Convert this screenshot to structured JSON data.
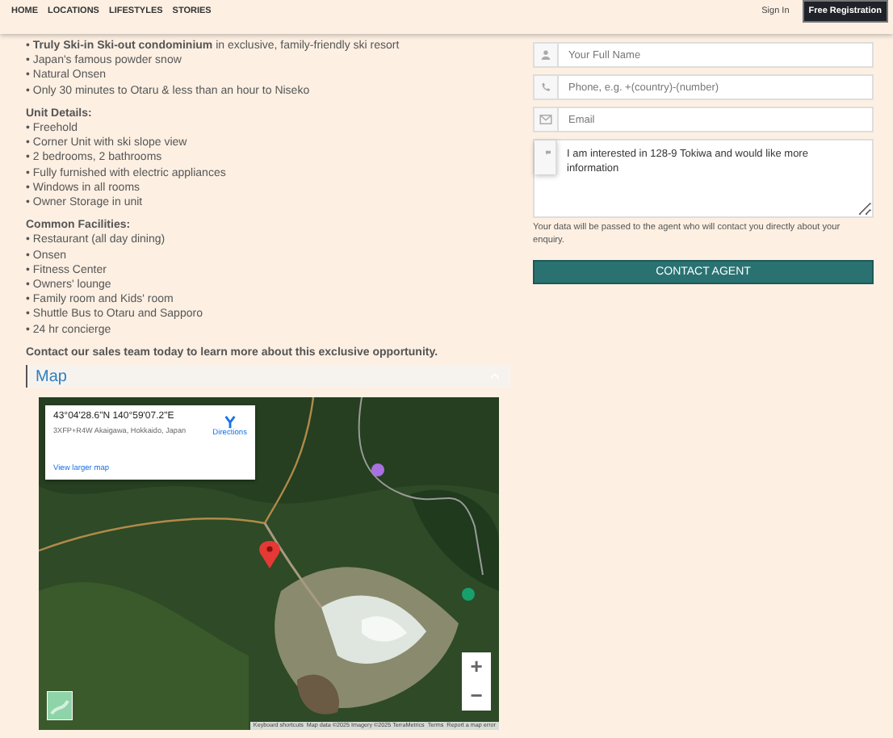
{
  "nav": {
    "items": [
      "HOME",
      "LOCATIONS",
      "LIFESTYLES",
      "STORIES"
    ],
    "sign_in": "Sign In",
    "register": "Free Registration"
  },
  "description": {
    "intro": [
      "• **Truly Ski-in Ski-out condominium** in exclusive, family-friendly ski resort",
      "• Japan's famous powder snow",
      "• Natural Onsen",
      "• Only 30 minutes to Otaru & less than an hour to Niseko"
    ],
    "sections": [
      {
        "heading": "Unit Details:",
        "bullets": [
          "• Freehold",
          "• Corner Unit with ski slope view",
          "• 2 bedrooms, 2 bathrooms",
          "• Fully furnished with electric appliances",
          "• Windows in all rooms",
          "• Owner Storage in unit"
        ]
      },
      {
        "heading": "Common Facilities:",
        "bullets": [
          "• Restaurant (all day dining)",
          "• Onsen",
          "• Fitness Center",
          "• Owners' lounge",
          "• Family room and Kids' room",
          "• Shuttle Bus to Otaru and Sapporo",
          "• 24 hr concierge"
        ]
      }
    ],
    "closing": "Contact our sales team today to learn more about this exclusive opportunity."
  },
  "map": {
    "heading": "Map",
    "info": {
      "coordinates": "43°04'28.6\"N 140°59'07.2\"E",
      "address": "3XFP+R4W Akaigawa, Hokkaido, Japan",
      "directions": "Directions",
      "link": "View larger map"
    },
    "zoom_in": "+",
    "zoom_out": "−",
    "attribution": [
      "Keyboard shortcuts",
      "Map data ©2025 Imagery ©2025 TerraMetrics",
      "Terms",
      "Report a map error"
    ]
  },
  "form": {
    "fields": [
      {
        "kind": "name",
        "placeholder": "Your Full Name"
      },
      {
        "kind": "phone",
        "placeholder": "Phone, e.g. +(country)-(number)"
      },
      {
        "kind": "email",
        "placeholder": "Email"
      }
    ],
    "message": "I am interested in 128-9 Tokiwa and would like more information",
    "note": "Your data will be passed to the agent who will contact you directly about your enquiry.",
    "button": "CONTACT AGENT"
  }
}
